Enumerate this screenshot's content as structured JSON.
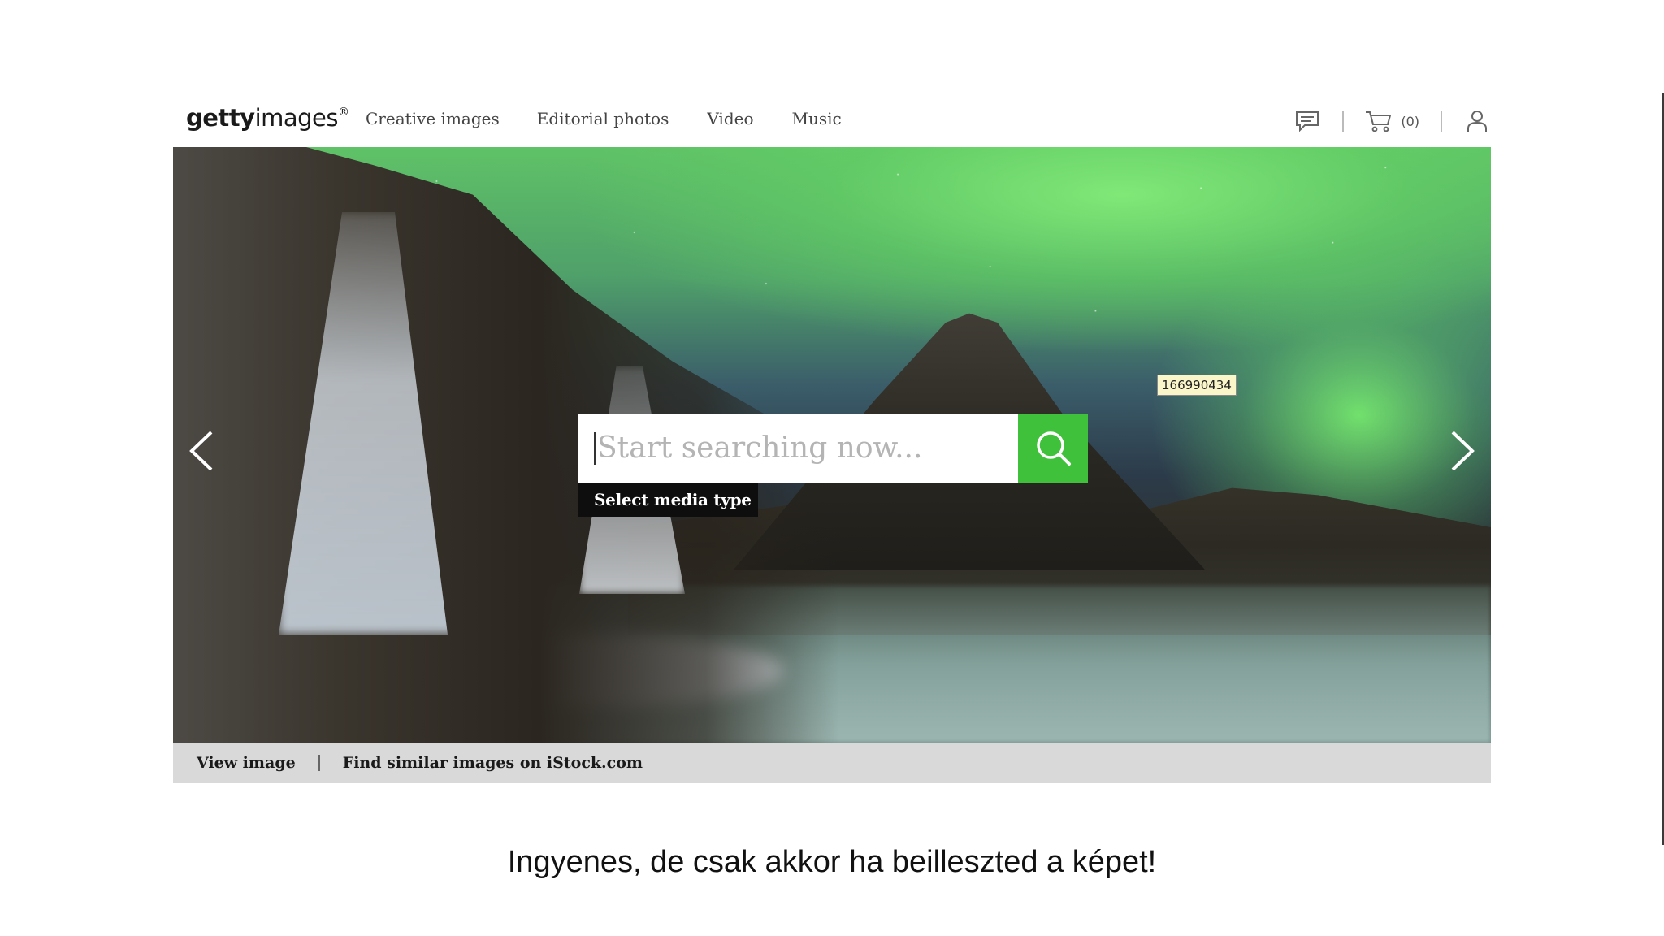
{
  "header": {
    "logo": {
      "bold": "getty",
      "regular": "images",
      "mark": "®"
    },
    "nav": [
      {
        "label": "Creative images"
      },
      {
        "label": "Editorial photos"
      },
      {
        "label": "Video"
      },
      {
        "label": "Music"
      }
    ],
    "cart_count": "(0)",
    "icons": [
      "chat-icon",
      "cart-icon",
      "user-icon"
    ]
  },
  "hero": {
    "image_id": "166990434",
    "search": {
      "placeholder": "Start searching now...",
      "value": ""
    },
    "media_type_label": "Select media type",
    "icons": [
      "chevron-left-icon",
      "chevron-right-icon",
      "search-icon"
    ],
    "accent_color": "#40c13b"
  },
  "caption_bar": {
    "view_image": "View image",
    "find_similar": "Find similar images on iStock.com"
  },
  "slide_caption": "Ingyenes, de csak akkor ha beilleszted a képet!"
}
